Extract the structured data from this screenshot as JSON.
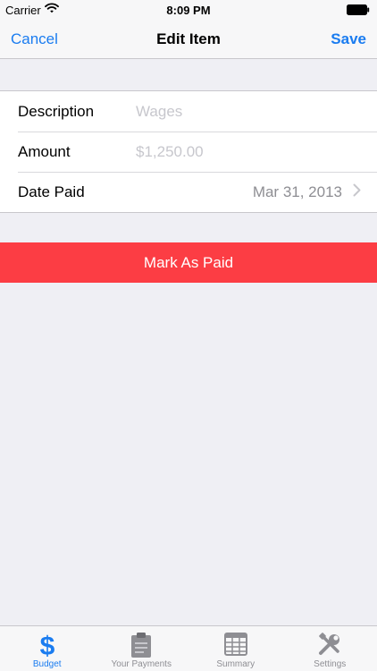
{
  "status_bar": {
    "carrier": "Carrier",
    "time": "8:09 PM"
  },
  "nav": {
    "cancel_label": "Cancel",
    "title": "Edit Item",
    "save_label": "Save"
  },
  "form": {
    "description": {
      "label": "Description",
      "placeholder": "Wages",
      "value": ""
    },
    "amount": {
      "label": "Amount",
      "placeholder": "$1,250.00",
      "value": ""
    },
    "date_paid": {
      "label": "Date Paid",
      "value": "Mar 31, 2013"
    }
  },
  "mark_paid_label": "Mark As Paid",
  "tabs": [
    {
      "label": "Budget",
      "icon": "dollar-icon",
      "active": true
    },
    {
      "label": "Your Payments",
      "icon": "clipboard-icon",
      "active": false
    },
    {
      "label": "Summary",
      "icon": "table-icon",
      "active": false
    },
    {
      "label": "Settings",
      "icon": "wrench-screwdriver-icon",
      "active": false
    }
  ],
  "colors": {
    "accent": "#1a7cf0",
    "destructive": "#fc3d44",
    "background": "#efeff4",
    "inactive": "#8e8e93"
  }
}
